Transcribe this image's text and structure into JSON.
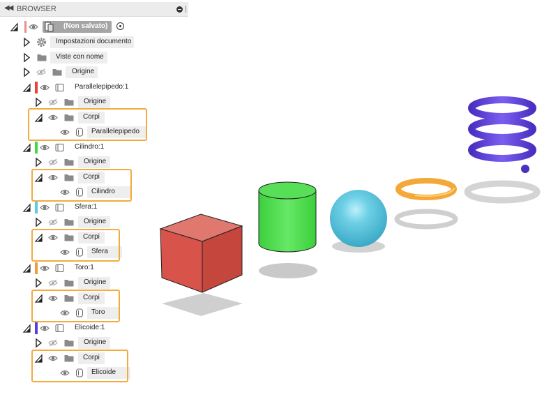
{
  "browser": {
    "title": "BROWSER",
    "root": {
      "label": "(Non salvato)"
    },
    "doc_settings": "Impostazioni documento",
    "named_views": "Viste con nome",
    "origin": "Origine",
    "bodies": "Corpi",
    "components": [
      {
        "name": "Parallelepipedo:1",
        "body": "Parallelepipedo",
        "color": "#e8433a"
      },
      {
        "name": "Cilindro:1",
        "body": "Cilindro",
        "color": "#3fdc3f"
      },
      {
        "name": "Sfera:1",
        "body": "Sfera",
        "color": "#5fc9e0"
      },
      {
        "name": "Toro:1",
        "body": "Toro",
        "color": "#f39a3a"
      },
      {
        "name": "Elicoide:1",
        "body": "Elicoide",
        "color": "#5a3fd6"
      }
    ]
  },
  "viewport": {
    "objects": [
      {
        "name": "Parallelepipedo",
        "color": "#d9534a"
      },
      {
        "name": "Cilindro",
        "color": "#55dd55"
      },
      {
        "name": "Sfera",
        "color": "#5ec4dc"
      },
      {
        "name": "Toro",
        "color": "#f5a83a"
      },
      {
        "name": "Elicoide",
        "color": "#5b3ed6"
      }
    ]
  }
}
